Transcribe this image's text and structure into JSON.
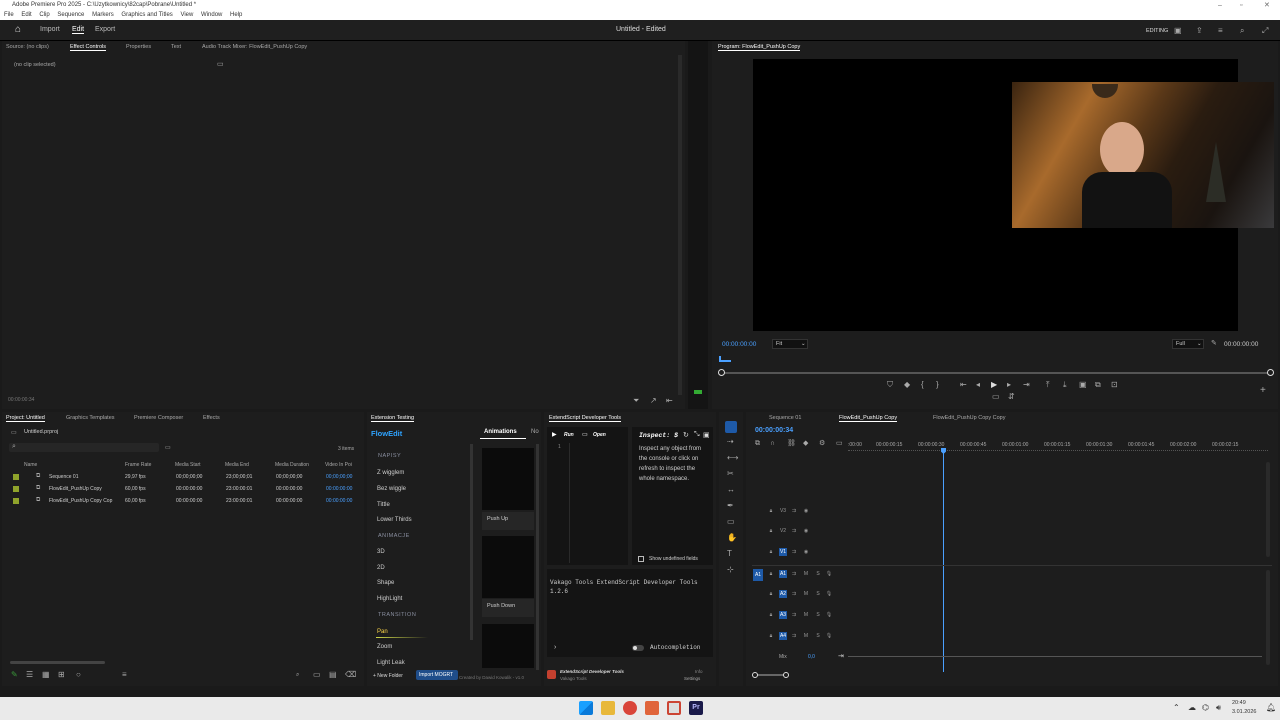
{
  "titlebar": {
    "title": "Adobe Premiere Pro 2025 - C:\\Uzytkownicy\\82cap\\Pobrane\\Untitled *"
  },
  "menu": [
    "File",
    "Edit",
    "Clip",
    "Sequence",
    "Markers",
    "Graphics and Titles",
    "View",
    "Window",
    "Help"
  ],
  "header": {
    "tabs": [
      "Import",
      "Edit",
      "Export"
    ],
    "title": "Untitled - Edited",
    "workspace": "EDITING"
  },
  "source": {
    "tabs": [
      "Source: (no clips)",
      "Effect Controls",
      "Properties",
      "Text",
      "Audio Track Mixer: FlowEdit_PushUp Copy"
    ],
    "no_clip": "(no clip selected)",
    "timecode": "00:00:00:34"
  },
  "program": {
    "tab": "Program: FlowEdit_PushUp Copy",
    "timecode_left": "00:00:00:00",
    "fit": "Fit",
    "quality": "Full",
    "timecode_right": "00:00:00:00"
  },
  "project": {
    "tabs": [
      "Project: Untitled",
      "Graphics Templates",
      "Premiere Composer",
      "Effects"
    ],
    "file": "Untitled.prproj",
    "items_count": "3 items",
    "columns": [
      "Name",
      "Frame Rate",
      "Media Start",
      "Media End",
      "Media Duration",
      "Video In Poi"
    ],
    "rows": [
      {
        "name": "Sequence 01",
        "fps": "29,97 fps",
        "start": "00;00;00;00",
        "end": "23;00;00;01",
        "dur": "00;00;00;00",
        "vin": "00;00;00;00"
      },
      {
        "name": "FlowEdit_PushUp Copy",
        "fps": "60,00 fps",
        "start": "00:00:00:00",
        "end": "23:00:00:01",
        "dur": "00:00:00:00",
        "vin": "00:00:00:00"
      },
      {
        "name": "FlowEdit_PushUp Copy Cop",
        "fps": "60,00 fps",
        "start": "00:00:00:00",
        "end": "23:00:00:01",
        "dur": "00:00:00:00",
        "vin": "00:00:00:00"
      }
    ]
  },
  "ext": {
    "tab": "Extension Testing",
    "brand": "FlowEdit",
    "tabs": [
      "Animations",
      "No"
    ],
    "sections": [
      {
        "header": "NAPISY",
        "items": [
          "Z wigglem",
          "Bez wiggle",
          "Tittle",
          "Lower Thirds"
        ]
      },
      {
        "header": "ANIMACJE",
        "items": [
          "3D",
          "2D",
          "Shape",
          "HighLight"
        ]
      },
      {
        "header": "TRANSITION",
        "items": [
          "Pan",
          "Zoom",
          "Light Leak"
        ]
      }
    ],
    "thumbs": [
      "Push Up",
      "Push Down"
    ],
    "new_folder": "+ New Folder",
    "import": "Import MOGRT",
    "credit": "Created by Dawid Kowalik - v1.0"
  },
  "estk": {
    "tab": "ExtendScript Developer Tools",
    "run": "Run",
    "open": "Open",
    "inspect_title": "Inspect: $",
    "inspect_text": [
      "Inspect any object from",
      "the console or click on",
      "refresh to inspect the",
      "whole namespace."
    ],
    "show_undefined": "Show undefined fields",
    "console_line1": "Vakago Tools ExtendScript Developer Tools",
    "console_line2": "1.2.6",
    "autocompletion": "Autocompletion",
    "footer_title": "ExtendScript Developer Tools",
    "footer_sub": "Vakago Tools",
    "footer_info": "Info",
    "footer_settings": "Settings",
    "line_num": "1"
  },
  "timeline": {
    "tabs": [
      "Sequence 01",
      "FlowEdit_PushUp Copy",
      "FlowEdit_PushUp Copy Copy"
    ],
    "timecode": "00:00:00:34",
    "ruler": [
      ":00:00",
      "00:00:00:15",
      "00:00:00:30",
      "00:00:00:45",
      "00:00:01:00",
      "00:00:01:15",
      "00:00:01:30",
      "00:00:01:45",
      "00:00:02:00",
      "00:00:02:15"
    ],
    "video_tracks": [
      "V3",
      "V2",
      "V1"
    ],
    "audio_tracks": [
      "A1",
      "A2",
      "A3",
      "A4"
    ],
    "mix": "Mix",
    "mix_val": "0,0"
  },
  "tray": {
    "time": "20:49",
    "date": "3.01.2026"
  },
  "colors": {
    "accent": "#2d8ceb",
    "label_green": "#8fa32b"
  }
}
